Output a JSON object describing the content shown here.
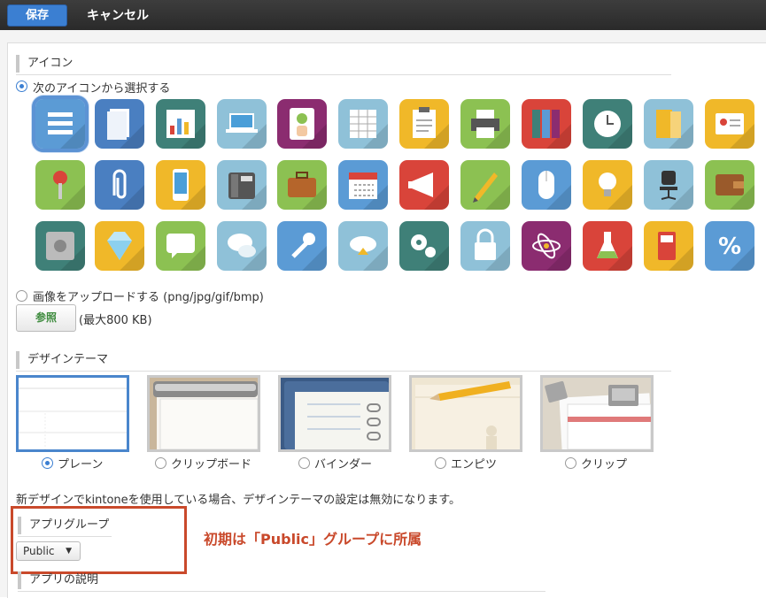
{
  "toolbar": {
    "save_label": "保存",
    "cancel_label": "キャンセル"
  },
  "icon_section": {
    "title": "アイコン",
    "choose_label": "次のアイコンから選択する",
    "upload_label": "画像をアップロードする (png/jpg/gif/bmp)",
    "browse_label": "参照",
    "max_size_label": "(最大800 KB)",
    "icons": [
      {
        "name": "list-icon",
        "color": "#5b9bd5"
      },
      {
        "name": "document-icon",
        "color": "#4a7fc1"
      },
      {
        "name": "bar-chart-icon",
        "color": "#3f8078"
      },
      {
        "name": "laptop-icon",
        "color": "#8fc1d8"
      },
      {
        "name": "hand-card-icon",
        "color": "#8b2c70"
      },
      {
        "name": "spreadsheet-icon",
        "color": "#8fc1d8"
      },
      {
        "name": "clipboard-icon",
        "color": "#f0b829"
      },
      {
        "name": "printer-icon",
        "color": "#8cc152"
      },
      {
        "name": "binders-icon",
        "color": "#d9443a"
      },
      {
        "name": "clock-icon",
        "color": "#3f8078"
      },
      {
        "name": "folder-icon",
        "color": "#8fc1d8"
      },
      {
        "name": "id-badge-icon",
        "color": "#f0b829"
      },
      {
        "name": "pushpin-icon",
        "color": "#8cc152"
      },
      {
        "name": "paperclip-icon",
        "color": "#4a7fc1"
      },
      {
        "name": "smartphone-icon",
        "color": "#f0b829"
      },
      {
        "name": "desk-phone-icon",
        "color": "#8fc1d8"
      },
      {
        "name": "briefcase-icon",
        "color": "#8cc152"
      },
      {
        "name": "calendar-icon",
        "color": "#5b9bd5"
      },
      {
        "name": "megaphone-icon",
        "color": "#d9443a"
      },
      {
        "name": "pencil-icon",
        "color": "#8cc152"
      },
      {
        "name": "mouse-icon",
        "color": "#5b9bd5"
      },
      {
        "name": "lightbulb-icon",
        "color": "#f0b829"
      },
      {
        "name": "office-chair-icon",
        "color": "#8fc1d8"
      },
      {
        "name": "wallet-icon",
        "color": "#8cc152"
      },
      {
        "name": "safe-icon",
        "color": "#3f8078"
      },
      {
        "name": "diamond-icon",
        "color": "#f0b829"
      },
      {
        "name": "chat-bubble-icon",
        "color": "#8cc152"
      },
      {
        "name": "chat-bubbles-icon",
        "color": "#8fc1d8"
      },
      {
        "name": "wrench-icon",
        "color": "#5b9bd5"
      },
      {
        "name": "cloud-upload-icon",
        "color": "#8fc1d8"
      },
      {
        "name": "gears-icon",
        "color": "#3f8078"
      },
      {
        "name": "padlock-icon",
        "color": "#8fc1d8"
      },
      {
        "name": "atom-icon",
        "color": "#8b2c70"
      },
      {
        "name": "flask-icon",
        "color": "#d9443a"
      },
      {
        "name": "fuel-pump-icon",
        "color": "#f0b829"
      },
      {
        "name": "percent-icon",
        "color": "#5b9bd5"
      }
    ]
  },
  "design_section": {
    "title": "デザインテーマ",
    "themes": [
      {
        "name": "plain",
        "label": "プレーン",
        "selected": true
      },
      {
        "name": "clipboard",
        "label": "クリップボード",
        "selected": false
      },
      {
        "name": "binder",
        "label": "バインダー",
        "selected": false
      },
      {
        "name": "pencil",
        "label": "エンピツ",
        "selected": false
      },
      {
        "name": "clip",
        "label": "クリップ",
        "selected": false
      }
    ],
    "note": "新デザインでkintoneを使用している場合、デザインテーマの設定は無効になります。"
  },
  "app_group": {
    "title": "アプリグループ",
    "value": "Public",
    "annotation": "初期は「Public」グループに所属"
  },
  "app_description": {
    "title": "アプリの説明"
  }
}
